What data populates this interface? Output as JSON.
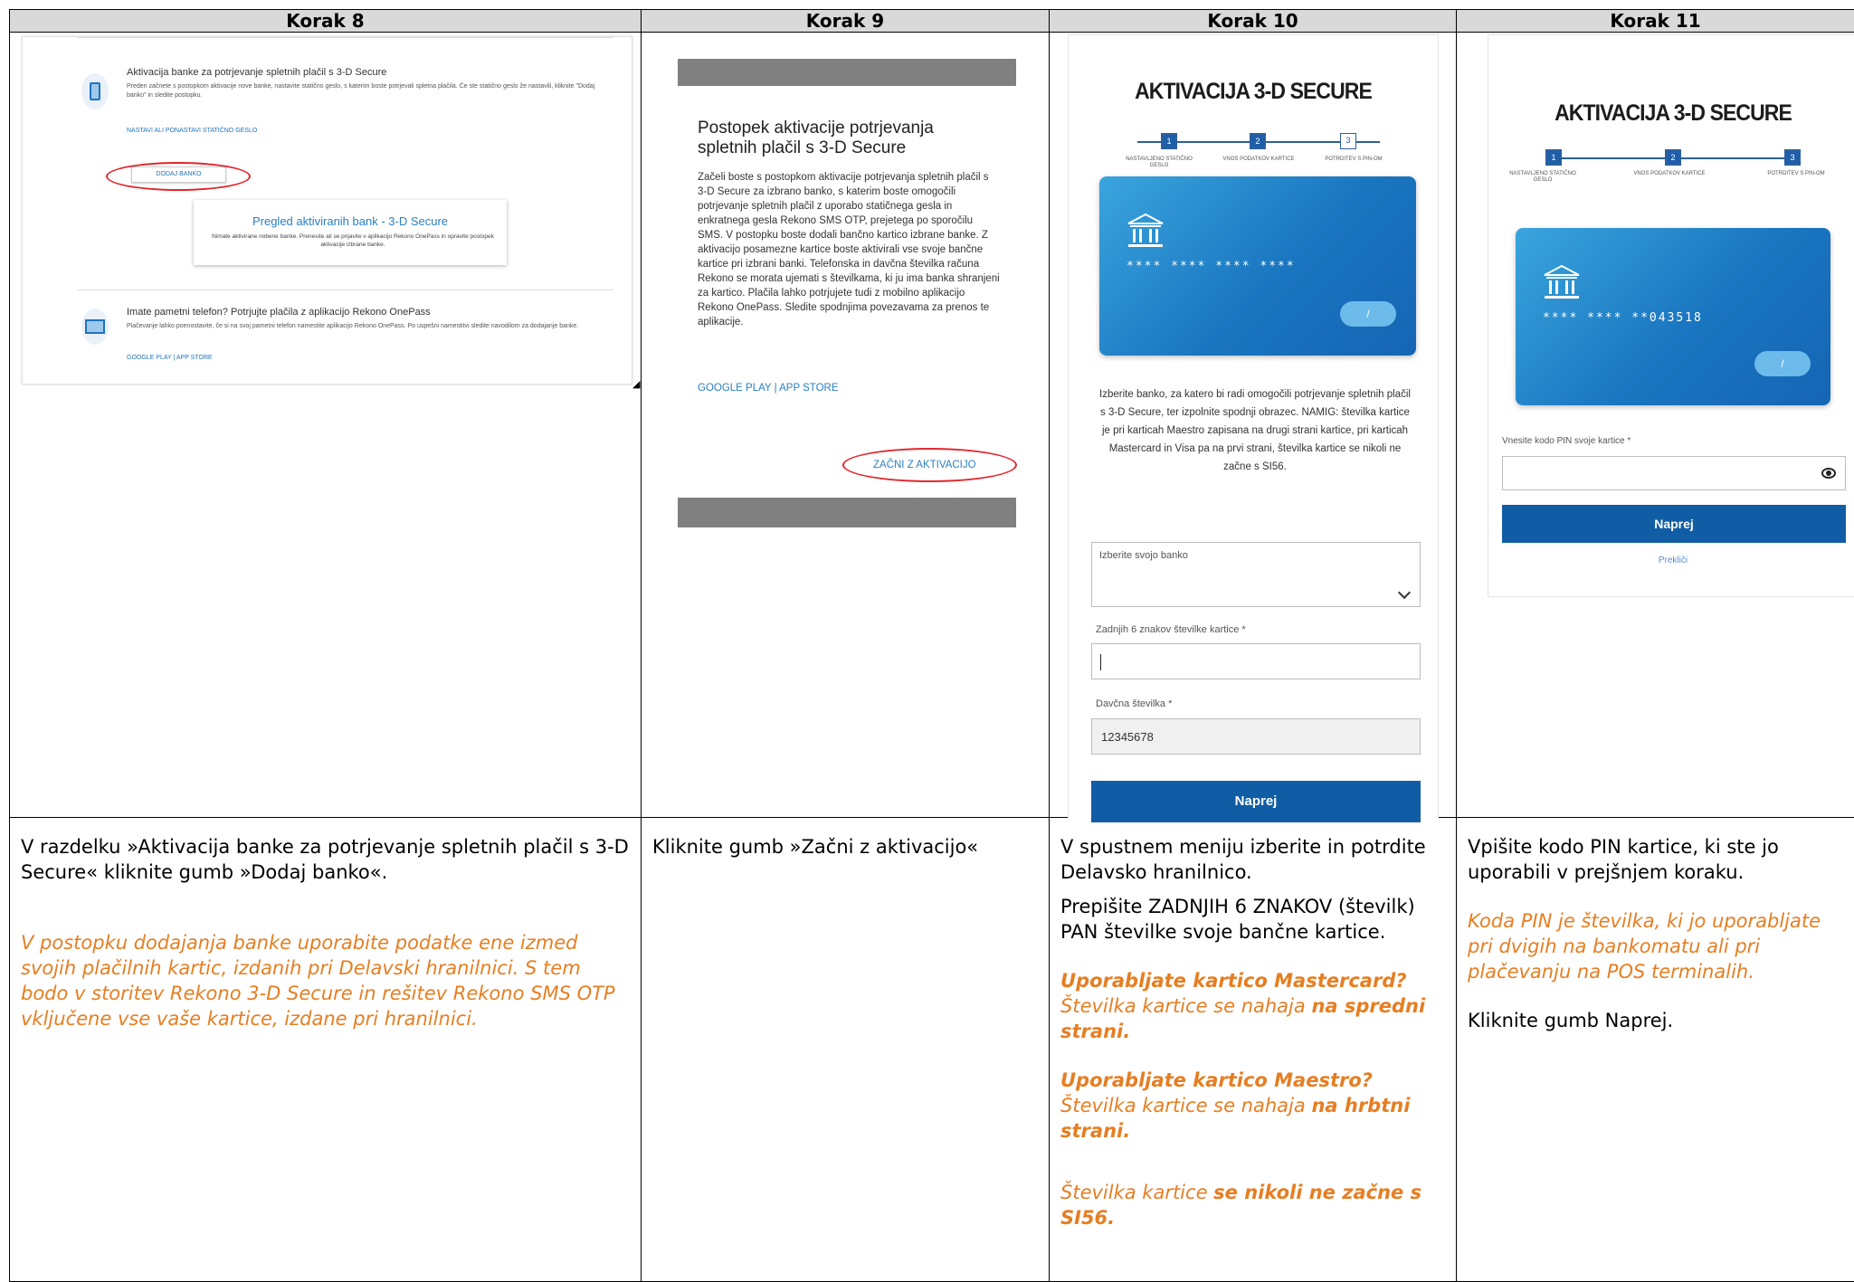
{
  "headers": [
    "Korak 8",
    "Korak 9",
    "Korak 10",
    "Korak 11"
  ],
  "step8": {
    "section1_title": "Aktivacija banke za potrjevanje spletnih plačil s 3-D Secure",
    "section1_text": "Preden začnete s postopkom aktivacije nove banke, nastavite statično geslo, s katerim boste potrjevali spletna plačila. Če ste statično geslo že nastavili, kliknite \"Dodaj banko\" in sledite postopku.",
    "section1_link": "NASTAVI ALI PONASTAVI STATIČNO GESLO",
    "add_bank_button": "DODAJ BANKO",
    "card_title": "Pregled aktiviranih bank - 3-D Secure",
    "card_text": "Nimate aktivirane nobene banke. Prenesite ali se prijavite v aplikacijo Rekono OnePass in opravite postopek aktivacije izbrane banke.",
    "section2_title": "Imate pametni telefon? Potrjujte plačila z aplikacijo Rekono OnePass",
    "section2_text": "Plačevanje lahko poenostavite, če si na svoj pametni telefon namestite aplikacijo Rekono OnePass. Po uspešni namestitvi sledite navodilom za dodajanje banke.",
    "section2_link": "GOOGLE PLAY | APP STORE",
    "desc": "V razdelku »Aktivacija banke za potrjevanje spletnih plačil s 3-D Secure« kliknite gumb »Dodaj banko«.",
    "note": "V postopku dodajanja banke uporabite podatke ene izmed svojih plačilnih kartic, izdanih pri Delavski hranilnici. S tem bodo v storitev Rekono 3-D Secure in rešitev Rekono SMS OTP vključene vse vaše kartice, izdane pri hranilnici."
  },
  "step9": {
    "modal_title": "Postopek aktivacije potrjevanja spletnih plačil s 3-D Secure",
    "modal_text": "Začeli boste s postopkom aktivacije potrjevanja spletnih plačil s 3-D Secure za izbrano banko, s katerim boste omogočili potrjevanje spletnih plačil z uporabo statičnega gesla in enkratnega gesla Rekono SMS OTP, prejetega po sporočilu SMS. V postopku boste dodali bančno kartico izbrane banke. Z aktivacijo posamezne kartice boste aktivirali vse svoje bančne kartice pri izbrani banki. Telefonska in davčna številka računa Rekono se morata ujemati s številkama, ki ju ima banka shranjeni za kartico. Plačila lahko potrjujete tudi z mobilno aplikacijo Rekono OnePass. Sledite spodnjima povezavama za prenos te aplikacije.",
    "link": "GOOGLE PLAY | APP STORE",
    "start_button": "ZAČNI Z AKTIVACIJO",
    "desc": "Kliknite gumb »Začni z aktivacijo«"
  },
  "step10": {
    "title": "AKTIVACIJA 3-D SECURE",
    "stepper": [
      "1",
      "2",
      "3"
    ],
    "stepper_labels": [
      "NASTAVLJENO STATIČNO GESLO",
      "VNOS PODATKOV KARTICE",
      "POTRDITEV S PIN-OM"
    ],
    "card_number": "**** **** **** ****",
    "card_toggle": "/",
    "description": "Izberite banko, za katero bi radi omogočili potrjevanje spletnih plačil s 3-D Secure, ter izpolnite spodnji obrazec. NAMIG: številka kartice je pri karticah Maestro zapisana na drugi strani kartice, pri karticah Mastercard in Visa pa na prvi strani, številka kartice se nikoli ne začne s SI56.",
    "select_label": "Izberite svojo banko",
    "card_digits_label": "Zadnjih 6 znakov številke kartice *",
    "tax_label": "Davčna številka *",
    "tax_value": "12345678",
    "next_button": "Naprej",
    "desc1": "V spustnem meniju izberite in potrdite Delavsko hranilnico.",
    "desc2": "Prepišite ZADNJIH 6 ZNAKOV (številk) PAN številke svoje bančne kartice.",
    "mc_q": "Uporabljate kartico Mastercard?",
    "mc_a1": "Številka kartice se nahaja ",
    "mc_a2": "na spredni strani.",
    "ma_q": "Uporabljate kartico Maestro?",
    "ma_a1": "Številka kartice se nahaja ",
    "ma_a2": "na hrbtni strani.",
    "si_a1": "Številka kartice ",
    "si_a2": "se nikoli ne začne s SI56."
  },
  "step11": {
    "title": "AKTIVACIJA 3-D SECURE",
    "stepper": [
      "1",
      "2",
      "3"
    ],
    "stepper_labels": [
      "NASTAVLJENO STATIČNO GESLO",
      "VNOS PODATKOV KARTICE",
      "POTRDITEV S PIN-OM"
    ],
    "card_number": "**** **** **043518",
    "card_toggle": "/",
    "pin_label": "Vnesite kodo PIN svoje kartice *",
    "next_button": "Naprej",
    "cancel_link": "Prekliči",
    "desc": "Vpišite kodo PIN kartice, ki ste jo uporabili v prejšnjem koraku.",
    "note": "Koda PIN je številka, ki jo uporabljate pri dvigih na bankomatu ali pri plačevanju na POS terminalih.",
    "desc2": "Kliknite gumb Naprej."
  },
  "colors": {
    "accent_blue": "#115da5",
    "note_orange": "#e67e22",
    "highlight_red": "#e0262c"
  }
}
